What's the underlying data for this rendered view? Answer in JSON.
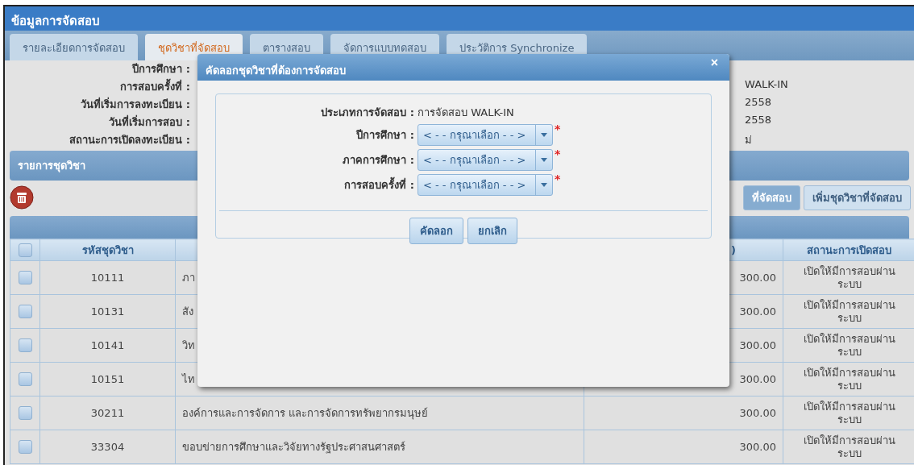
{
  "window": {
    "title": "ข้อมูลการจัดสอบ"
  },
  "tabs": [
    {
      "label": "รายละเอียดการจัดสอบ",
      "selected": false
    },
    {
      "label": "ชุดวิชาที่จัดสอบ",
      "selected": true
    },
    {
      "label": "ตารางสอบ",
      "selected": false
    },
    {
      "label": "จัดการแบบทดสอบ",
      "selected": false
    },
    {
      "label": "ประวัติการ Synchronize",
      "selected": false
    }
  ],
  "info": [
    {
      "label": "ปีการศึกษา :"
    },
    {
      "label": "การสอบครั้งที่ :",
      "value": "WALK-IN"
    },
    {
      "label": "วันที่เริ่มการลงทะเบียน :",
      "value": "2558"
    },
    {
      "label": "วันที่เริ่มการสอบ :",
      "value": "2558"
    },
    {
      "label": "สถานะการเปิดลงทะเบียน :",
      "value": "ม่"
    }
  ],
  "list_header": "รายการชุดวิชา",
  "toolbar": {
    "buttons": [
      "ที่จัดสอบ",
      "เพิ่มชุดวิชาที่จัดสอบ"
    ]
  },
  "table": {
    "header_checked": false,
    "columns": [
      {
        "kind": "centered",
        "label": "รหัสชุดวิชา"
      },
      {
        "kind": "plain"
      },
      {
        "kind": "numeric",
        "label": ")"
      },
      {
        "kind": "wrapped",
        "label": "สถานะการเปิดสอบ"
      }
    ],
    "rows": [
      {
        "checked": false,
        "code": "10111",
        "name": "ภา",
        "fee": "300.00",
        "status": "เปิดให้มีการสอบผ่านระบบ"
      },
      {
        "checked": false,
        "code": "10131",
        "name": "สัง",
        "fee": "300.00",
        "status": "เปิดให้มีการสอบผ่านระบบ"
      },
      {
        "checked": false,
        "code": "10141",
        "name": "วิท",
        "fee": "300.00",
        "status": "เปิดให้มีการสอบผ่านระบบ"
      },
      {
        "checked": false,
        "code": "10151",
        "name": "ไท",
        "fee": "300.00",
        "status": "เปิดให้มีการสอบผ่านระบบ"
      },
      {
        "checked": false,
        "code": "30211",
        "name": "องค์การและการจัดการ และการจัดการทรัพยากรมนุษย์",
        "fee": "300.00",
        "status": "เปิดให้มีการสอบผ่านระบบ"
      },
      {
        "checked": false,
        "code": "33304",
        "name": "ขอบข่ายการศึกษาและวิจัยทางรัฐประศาสนศาสตร์",
        "fee": "300.00",
        "status": "เปิดให้มีการสอบผ่านระบบ"
      }
    ]
  },
  "dialog": {
    "title": "คัดลอกชุดวิชาที่ต้องการจัดสอบ",
    "close": "×",
    "fields": [
      {
        "kind": "text",
        "label": "ประเภทการจัดสอบ :",
        "value": "การจัดสอบ WALK-IN"
      },
      {
        "kind": "select",
        "label": "ปีการศึกษา :",
        "value": "< - - กรุณาเลือก - - >",
        "required_mark": "*"
      },
      {
        "kind": "select",
        "label": "ภาคการศึกษา :",
        "value": "< - - กรุณาเลือก - - >",
        "required_mark": "*"
      },
      {
        "kind": "select",
        "label": "การสอบครั้งที่ :",
        "value": "< - - กรุณาเลือก - - >",
        "required_mark": "*"
      }
    ],
    "buttons": [
      "คัดลอก",
      "ยกเลิก"
    ]
  }
}
